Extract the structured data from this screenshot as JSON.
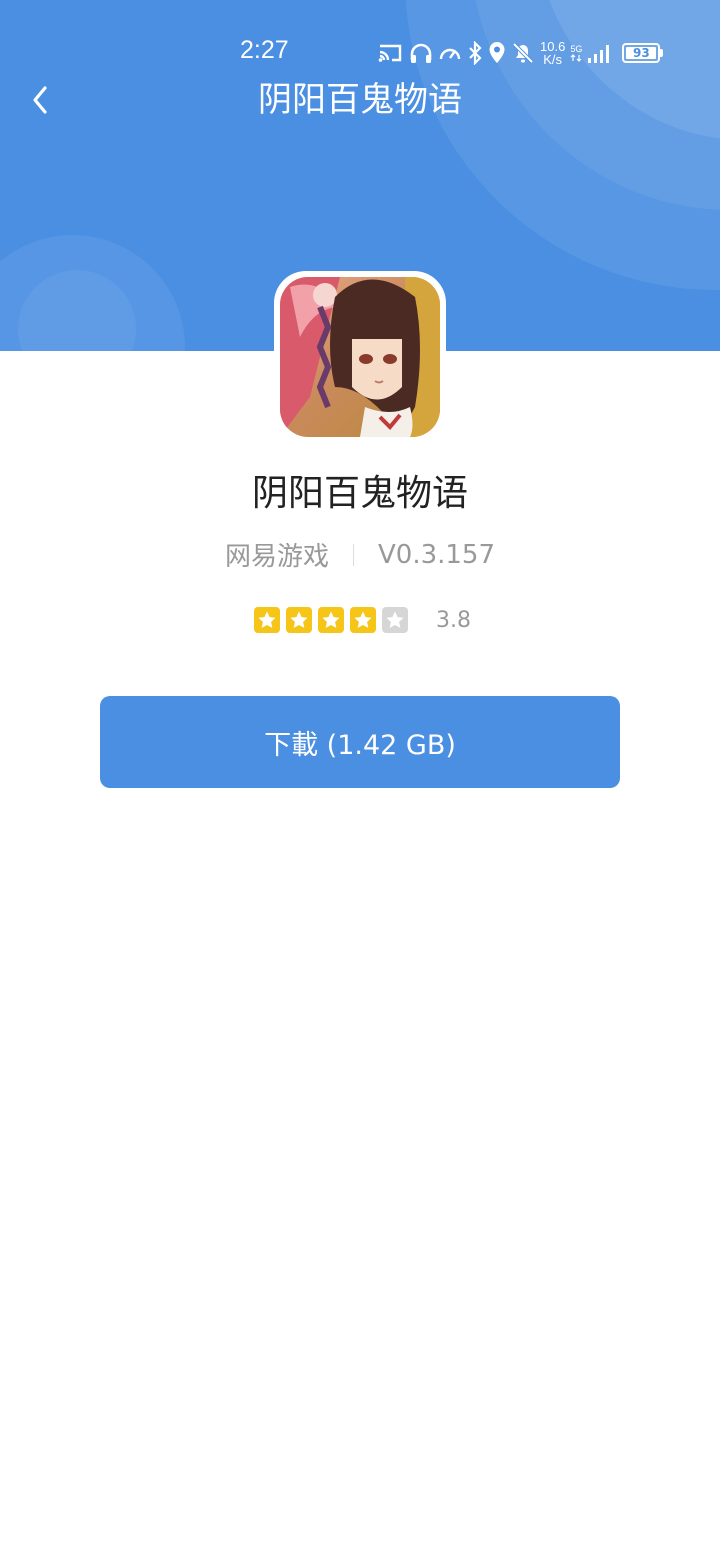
{
  "status_bar": {
    "time": "2:27",
    "net_speed_value": "10.6",
    "net_speed_unit": "K/s",
    "network_type": "5G",
    "battery": "93",
    "icons": [
      "cast-icon",
      "headphones-icon",
      "speedometer-icon",
      "bluetooth-icon",
      "location-icon",
      "mute-bell-icon",
      "signal-icon",
      "battery-icon"
    ]
  },
  "nav": {
    "back_icon": "chevron-left-icon",
    "title": "阴阳百鬼物语"
  },
  "app": {
    "name": "阴阳百鬼物语",
    "publisher": "网易游戏",
    "version": "V0.3.157",
    "rating": "3.8",
    "rating_stars": 4,
    "max_stars": 5
  },
  "download": {
    "label": "下載 (1.42 GB)"
  },
  "colors": {
    "primary": "#4a8fe2",
    "star": "#f5c518",
    "star_empty": "#d6d6d6",
    "text": "#222222",
    "muted": "#999999"
  }
}
